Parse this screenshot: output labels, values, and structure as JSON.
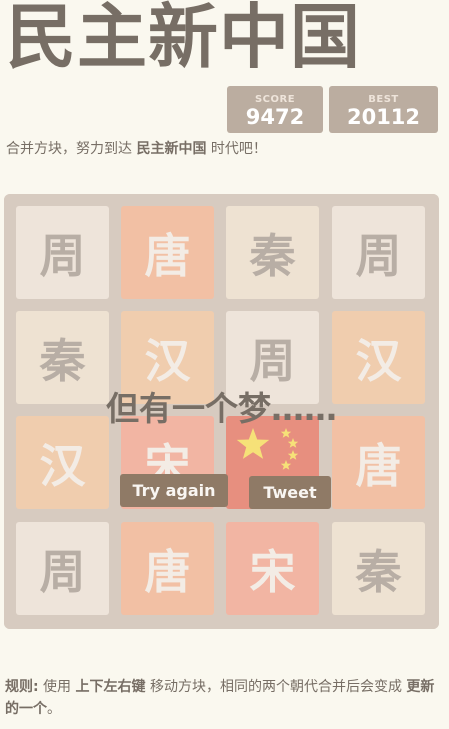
{
  "header": {
    "title": "民主新中国",
    "score_label": "SCORE",
    "score_value": "9472",
    "best_label": "BEST",
    "best_value": "20112"
  },
  "intro": {
    "prefix": "合并方块，努力到达 ",
    "goal": "民主新中国",
    "suffix": " 时代吧！"
  },
  "board": {
    "tiles": [
      [
        "周",
        "唐",
        "秦",
        "周"
      ],
      [
        "秦",
        "汉",
        "周",
        "汉"
      ],
      [
        "汉",
        "宋",
        "",
        "唐"
      ],
      [
        "周",
        "唐",
        "宋",
        "秦"
      ]
    ],
    "colors": {
      "周": {
        "bg": "#eee4da",
        "fg": "#776e65"
      },
      "秦": {
        "bg": "#ede0c8",
        "fg": "#776e65"
      },
      "汉": {
        "bg": "#f2b179",
        "fg": "#f9f6f2"
      },
      "唐": {
        "bg": "#f59563",
        "fg": "#f9f6f2"
      },
      "宋": {
        "bg": "#f67c5f",
        "fg": "#f9f6f2"
      }
    },
    "flag_tile_color": "#de2910",
    "flag_star_color": "#ffde00"
  },
  "game_over": {
    "message": "但有一个梦……",
    "try_again": "Try again",
    "tweet": "Tweet"
  },
  "rules": {
    "label": "规则:",
    "text1": " 使用 ",
    "keys": "上下左右键",
    "text2": " 移动方块，相同的两个朝代合并后会变成 ",
    "newer": "更新的一个",
    "end": "。"
  }
}
